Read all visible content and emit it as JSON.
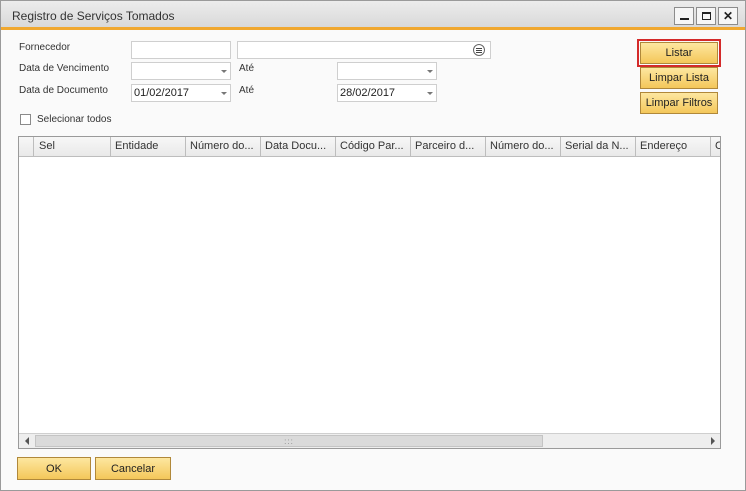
{
  "window": {
    "title": "Registro de Serviços Tomados"
  },
  "filters": {
    "fornecedor_label": "Fornecedor",
    "fornecedor_code": "",
    "fornecedor_name": "",
    "vencimento_label": "Data de Vencimento",
    "vencimento_from": "",
    "vencimento_ate_label": "Até",
    "vencimento_to": "",
    "documento_label": "Data de Documento",
    "documento_from": "01/02/2017",
    "documento_ate_label": "Até",
    "documento_to": "28/02/2017",
    "select_all_label": "Selecionar todos"
  },
  "buttons": {
    "listar": "Listar",
    "limpar_lista": "Limpar Lista",
    "limpar_filtros": "Limpar Filtros",
    "ok": "OK",
    "cancelar": "Cancelar"
  },
  "grid": {
    "columns": [
      "Sel",
      "Entidade",
      "Número do...",
      "Data Docu...",
      "Código Par...",
      "Parceiro d...",
      "Número do...",
      "Serial da N...",
      "Endereço",
      "C"
    ],
    "rows": []
  },
  "colors": {
    "accent": "#f0a830",
    "button": "#f4c75a",
    "highlight": "#d42a2a"
  }
}
